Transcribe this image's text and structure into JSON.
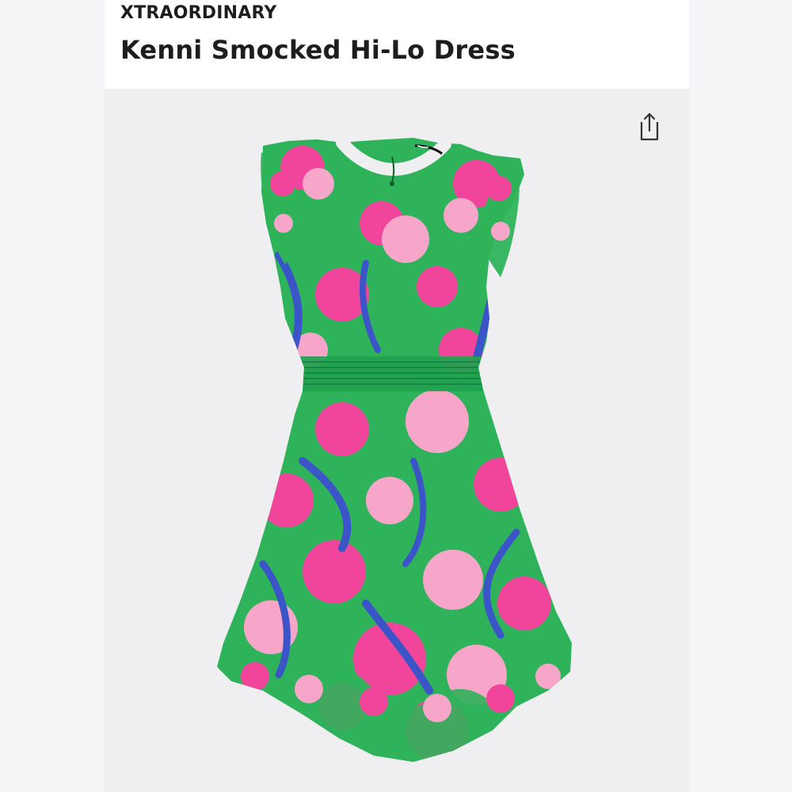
{
  "product": {
    "brand": "XTRAORDINARY",
    "title": "Kenni Smocked Hi-Lo Dress"
  },
  "image": {
    "subject": "dress-image",
    "colors": {
      "green": "#2fb35a",
      "pink": "#f0459a",
      "light_pink": "#f7a6c9",
      "blue": "#3b55c8",
      "panel_bg": "#efeff2"
    }
  },
  "icons": {
    "share": "share-icon"
  }
}
